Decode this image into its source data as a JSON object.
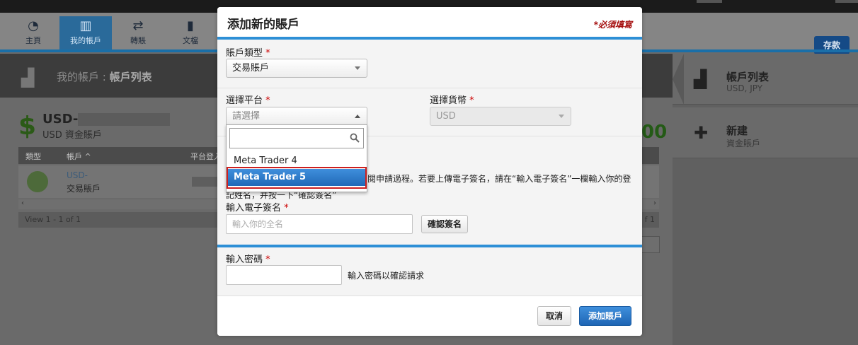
{
  "app": {
    "nav": [
      {
        "label": "主頁",
        "icon": "dashboard-icon"
      },
      {
        "label": "我的帳戶",
        "icon": "bar-chart-icon",
        "active": true
      },
      {
        "label": "轉賬",
        "icon": "transfer-icon"
      },
      {
        "label": "文檔",
        "icon": "folder-icon"
      }
    ],
    "save_button": "存款",
    "breadcrumb": {
      "prefix": "我的帳戶 : ",
      "current": "帳戶列表"
    },
    "account": {
      "title_prefix": "USD-",
      "subtitle": "USD 資金賬戶",
      "balance_suffix": "00"
    },
    "grid": {
      "headers": [
        "類型",
        "帳戶 ^",
        "平台登入"
      ],
      "row": {
        "account": "USD-",
        "type": "交易賬戶"
      },
      "footer_left": "View 1 - 1 of 1",
      "footer_right": "f 1"
    },
    "right_panel": [
      {
        "title": "帳戶列表",
        "subtitle": "USD, JPY"
      },
      {
        "title": "新建",
        "subtitle": "資金賬戶"
      }
    ]
  },
  "modal": {
    "title": "添加新的賬戶",
    "required_note": "*必須填寫",
    "account_type": {
      "label": "賬戶類型",
      "value": "交易賬戶"
    },
    "platform": {
      "label": "選擇平台",
      "placeholder": "請選擇"
    },
    "currency": {
      "label": "選擇貨幣",
      "value": "USD"
    },
    "notice_line1": "閱申請過程。若要上傳電子簽名，請在“輸入電子簽名”一欄輸入你的登",
    "notice_line2": "記姓名，并按一下“確認簽名”",
    "signature": {
      "label": "輸入電子簽名",
      "placeholder": "輸入你的全名",
      "confirm_button": "確認簽名"
    },
    "password": {
      "label": "輸入密碼",
      "hint": "輸入密碼以確認請求"
    },
    "cancel_button": "取消",
    "add_button": "添加賬戶",
    "dropdown": {
      "search_value": "",
      "options": [
        "Meta Trader 4",
        "Meta Trader 5"
      ],
      "highlighted_index": 1
    }
  },
  "colors": {
    "accent": "#2d8fd6",
    "required": "#a50d0d",
    "highlight_border": "#cc1f1f",
    "primary_button": "#1e65b4"
  }
}
